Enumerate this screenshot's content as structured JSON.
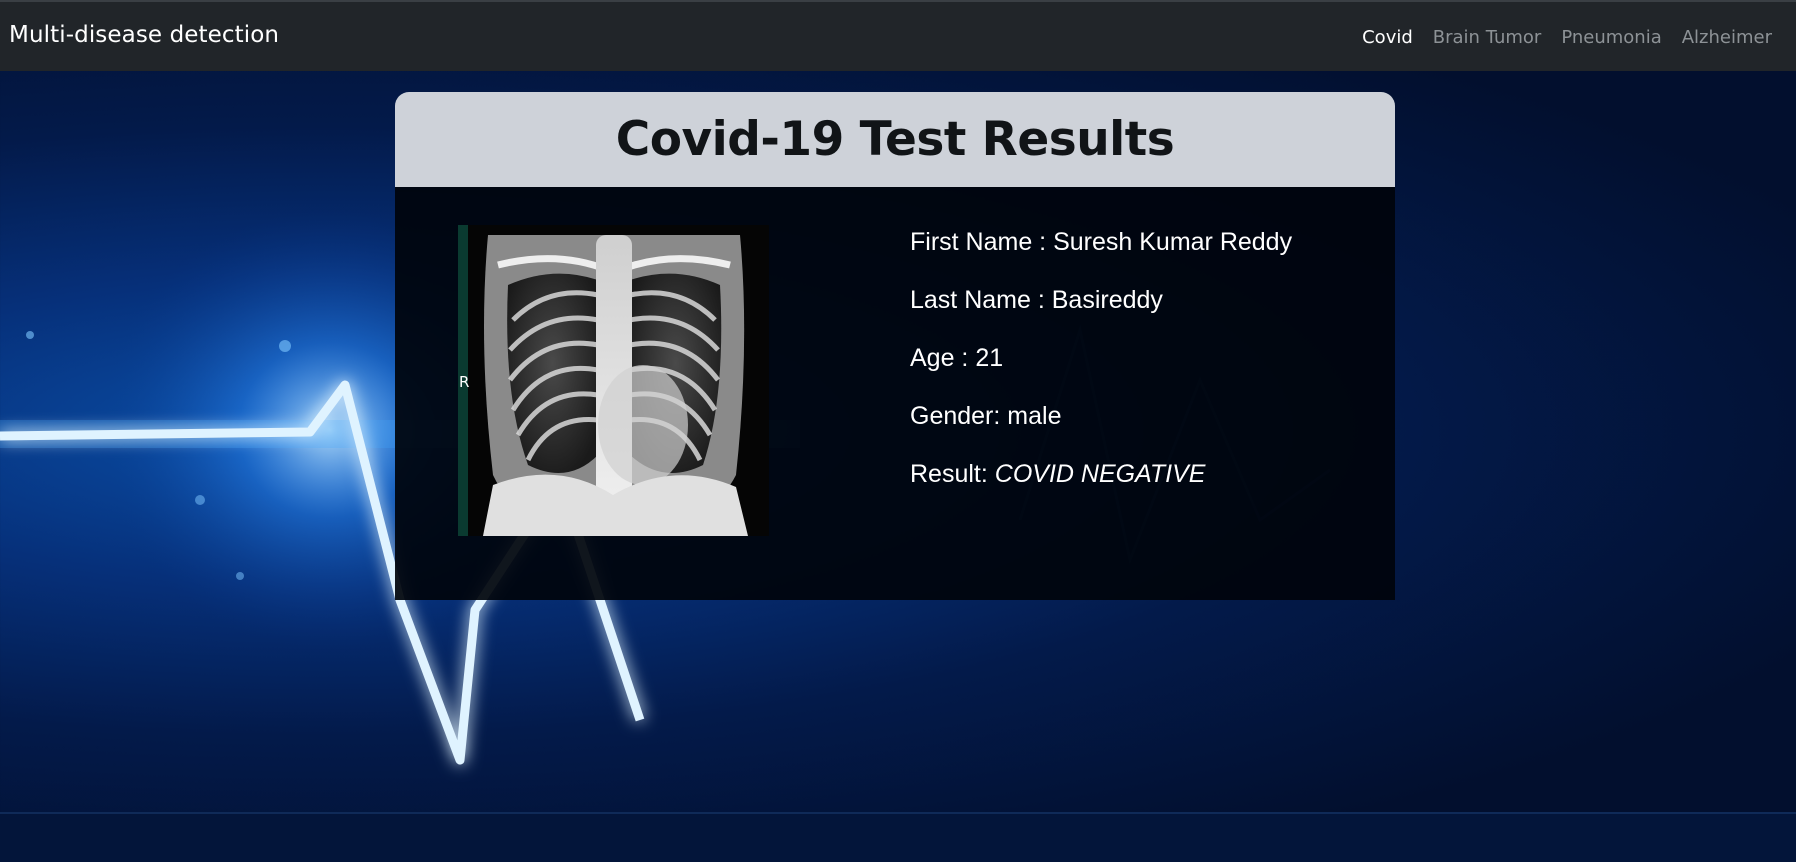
{
  "navbar": {
    "brand": "Multi-disease detection",
    "links": [
      {
        "label": "Covid",
        "active": true
      },
      {
        "label": "Brain Tumor",
        "active": false
      },
      {
        "label": "Pneumonia",
        "active": false
      },
      {
        "label": "Alzheimer",
        "active": false
      }
    ]
  },
  "card": {
    "title": "Covid-19 Test Results",
    "image_marker": "R",
    "fields": {
      "first_name_label": "First Name : ",
      "first_name": "Suresh Kumar Reddy",
      "last_name_label": "Last Name : ",
      "last_name": "Basireddy",
      "age_label": "Age : ",
      "age": "21",
      "gender_label": "Gender: ",
      "gender": "male",
      "result_label": "Result: ",
      "result": "COVID NEGATIVE"
    }
  },
  "colors": {
    "navbar_bg": "#212529",
    "header_bg": "#ced2d9",
    "body_bg": "#00040c",
    "accent_glow": "#3fb2ff"
  }
}
